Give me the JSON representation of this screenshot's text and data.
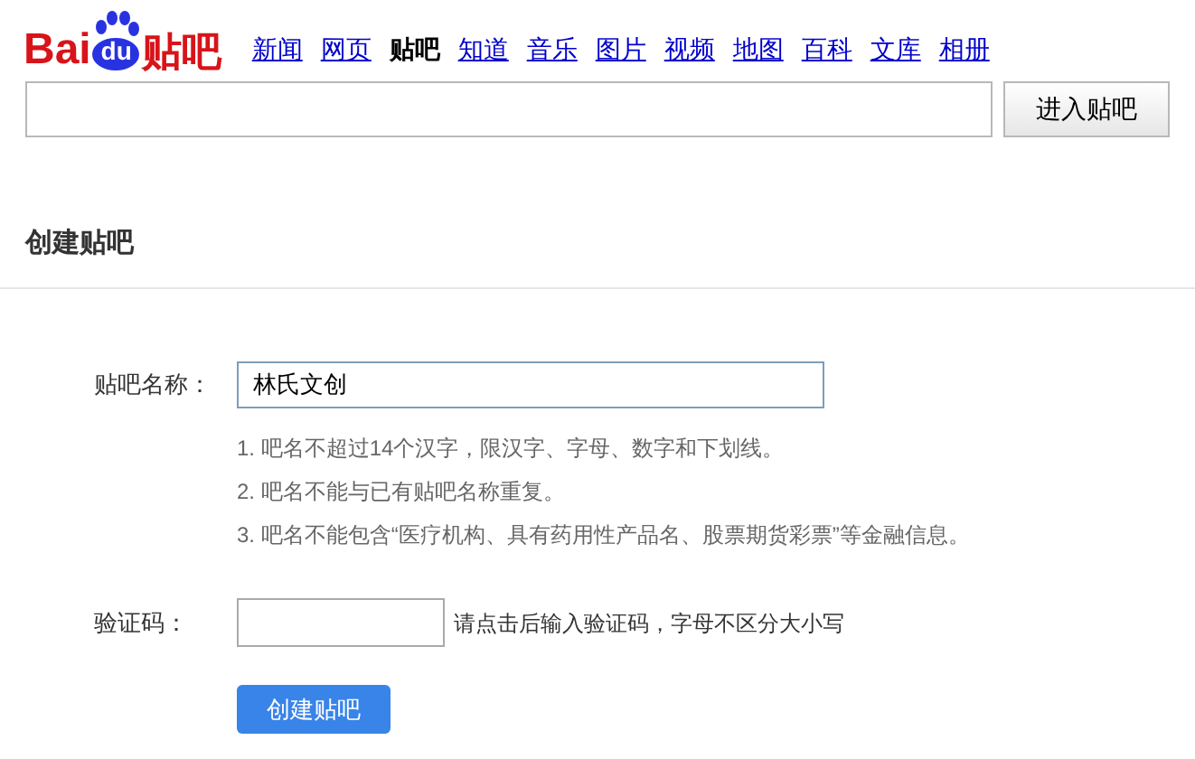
{
  "logo": {
    "left": "Bai",
    "paw": "du",
    "right": "贴吧"
  },
  "nav": [
    {
      "label": "新闻",
      "selected": false
    },
    {
      "label": "网页",
      "selected": false
    },
    {
      "label": "贴吧",
      "selected": true
    },
    {
      "label": "知道",
      "selected": false
    },
    {
      "label": "音乐",
      "selected": false
    },
    {
      "label": "图片",
      "selected": false
    },
    {
      "label": "视频",
      "selected": false
    },
    {
      "label": "地图",
      "selected": false
    },
    {
      "label": "百科",
      "selected": false
    },
    {
      "label": "文库",
      "selected": false
    },
    {
      "label": "相册",
      "selected": false
    }
  ],
  "search": {
    "button": "进入贴吧"
  },
  "section_title": "创建贴吧",
  "form": {
    "name_label": "贴吧名称：",
    "name_value": "林氏文创",
    "rules": [
      "1. 吧名不超过14个汉字，限汉字、字母、数字和下划线。",
      "2. 吧名不能与已有贴吧名称重复。",
      "3. 吧名不能包含“医疗机构、具有药用性产品名、股票期货彩票”等金融信息。"
    ],
    "captcha_label": "验证码：",
    "captcha_hint": "请点击后输入验证码，字母不区分大小写",
    "submit": "创建贴吧"
  }
}
